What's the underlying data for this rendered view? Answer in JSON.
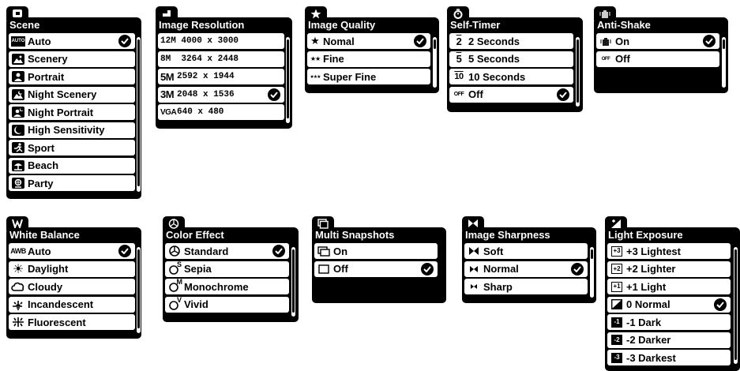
{
  "menus": {
    "scene": {
      "title": "Scene",
      "tab_icon": "scene-mode-icon",
      "items": [
        {
          "label": "Auto",
          "icon": "auto-icon",
          "icon_text": "AUTO",
          "selected": true
        },
        {
          "label": "Scenery",
          "icon": "scenery-icon",
          "selected": false
        },
        {
          "label": "Portrait",
          "icon": "portrait-icon",
          "selected": false
        },
        {
          "label": "Night Scenery",
          "icon": "night-scenery-icon",
          "selected": false
        },
        {
          "label": "Night Portrait",
          "icon": "night-portrait-icon",
          "selected": false
        },
        {
          "label": "High Sensitivity",
          "icon": "high-sensitivity-icon",
          "selected": false
        },
        {
          "label": "Sport",
          "icon": "sport-icon",
          "selected": false
        },
        {
          "label": "Beach",
          "icon": "beach-icon",
          "selected": false
        },
        {
          "label": "Party",
          "icon": "party-icon",
          "selected": false
        }
      ]
    },
    "image_resolution": {
      "title": "Image Resolution",
      "tab_icon": "resolution-icon",
      "items": [
        {
          "label": "12M 4000 x 3000",
          "selected": false
        },
        {
          "label": "8M  3264 x 2448",
          "selected": false
        },
        {
          "icon_text": "5M",
          "label": "2592 x 1944",
          "selected": false
        },
        {
          "icon_text": "3M",
          "label": "2048 x 1536",
          "selected": true
        },
        {
          "icon_text": "VGA",
          "label": "640 x 480",
          "selected": false
        }
      ]
    },
    "image_quality": {
      "title": "Image Quality",
      "tab_icon": "star-icon",
      "items": [
        {
          "label": "Nomal",
          "icon": "one-star-icon",
          "icon_text": "★",
          "selected": true
        },
        {
          "label": "Fine",
          "icon": "two-star-icon",
          "icon_text": "★★",
          "selected": false
        },
        {
          "label": "Super Fine",
          "icon": "three-star-icon",
          "icon_text": "★★★",
          "selected": false
        }
      ]
    },
    "self_timer": {
      "title": "Self-Timer",
      "tab_icon": "timer-icon",
      "items": [
        {
          "label": "2 Seconds",
          "icon": "timer-2-icon",
          "icon_text": "2",
          "selected": false
        },
        {
          "label": "5 Seconds",
          "icon": "timer-5-icon",
          "icon_text": "5",
          "selected": false
        },
        {
          "label": "10 Seconds",
          "icon": "timer-10-icon",
          "icon_text": "10",
          "selected": false
        },
        {
          "label": "Off",
          "icon": "timer-off-icon",
          "icon_text": "OFF",
          "selected": true
        }
      ]
    },
    "anti_shake": {
      "title": "Anti-Shake",
      "tab_icon": "hand-shake-icon",
      "items": [
        {
          "label": "On",
          "icon": "hand-on-icon",
          "selected": true
        },
        {
          "label": "Off",
          "icon": "hand-off-icon",
          "icon_text": "OFF",
          "selected": false
        }
      ]
    },
    "white_balance": {
      "title": "White Balance",
      "tab_icon": "white-balance-icon",
      "items": [
        {
          "label": "Auto",
          "icon": "awb-icon",
          "icon_text": "AWB",
          "selected": true
        },
        {
          "label": "Daylight",
          "icon": "sun-icon",
          "icon_text": "☀",
          "selected": false
        },
        {
          "label": "Cloudy",
          "icon": "cloud-icon",
          "icon_text": "☁",
          "selected": false
        },
        {
          "label": "Incandescent",
          "icon": "bulb-icon",
          "selected": false
        },
        {
          "label": "Fluorescent",
          "icon": "fluorescent-icon",
          "selected": false
        }
      ]
    },
    "color_effect": {
      "title": "Color Effect",
      "tab_icon": "color-circles-icon",
      "items": [
        {
          "label": "Standard",
          "icon": "standard-color-icon",
          "selected": true
        },
        {
          "label": "Sepia",
          "icon": "sepia-icon",
          "icon_text": "S",
          "selected": false
        },
        {
          "label": "Monochrome",
          "icon": "monochrome-icon",
          "icon_text": "M",
          "selected": false
        },
        {
          "label": "Vivid",
          "icon": "vivid-icon",
          "icon_text": "V",
          "selected": false
        }
      ]
    },
    "multi_snapshots": {
      "title": "Multi Snapshots",
      "tab_icon": "stacked-frames-icon",
      "items": [
        {
          "label": "On",
          "icon": "multi-on-icon",
          "selected": false
        },
        {
          "label": "Off",
          "icon": "multi-off-icon",
          "selected": true
        }
      ]
    },
    "image_sharpness": {
      "title": "Image Sharpness",
      "tab_icon": "sharpness-icon",
      "items": [
        {
          "label": "Soft",
          "icon": "soft-icon",
          "selected": false
        },
        {
          "label": "Normal",
          "icon": "normal-sharp-icon",
          "selected": true
        },
        {
          "label": "Sharp",
          "icon": "sharp-icon",
          "selected": false
        }
      ]
    },
    "light_exposure": {
      "title": "Light Exposure",
      "tab_icon": "exposure-icon",
      "items": [
        {
          "label": "+3 Lightest",
          "icon": "ev-plus3-icon",
          "icon_text": "+3",
          "selected": false
        },
        {
          "label": "+2 Lighter",
          "icon": "ev-plus2-icon",
          "icon_text": "+2",
          "selected": false
        },
        {
          "label": "+1 Light",
          "icon": "ev-plus1-icon",
          "icon_text": "+1",
          "selected": false
        },
        {
          "label": "0 Normal",
          "icon": "ev-zero-icon",
          "selected": true
        },
        {
          "label": "-1 Dark",
          "icon": "ev-minus1-icon",
          "icon_text": "-1",
          "selected": false
        },
        {
          "label": "-2 Darker",
          "icon": "ev-minus2-icon",
          "icon_text": "-2",
          "selected": false
        },
        {
          "label": "-3 Darkest",
          "icon": "ev-minus3-icon",
          "icon_text": "-3",
          "selected": false
        }
      ]
    }
  }
}
